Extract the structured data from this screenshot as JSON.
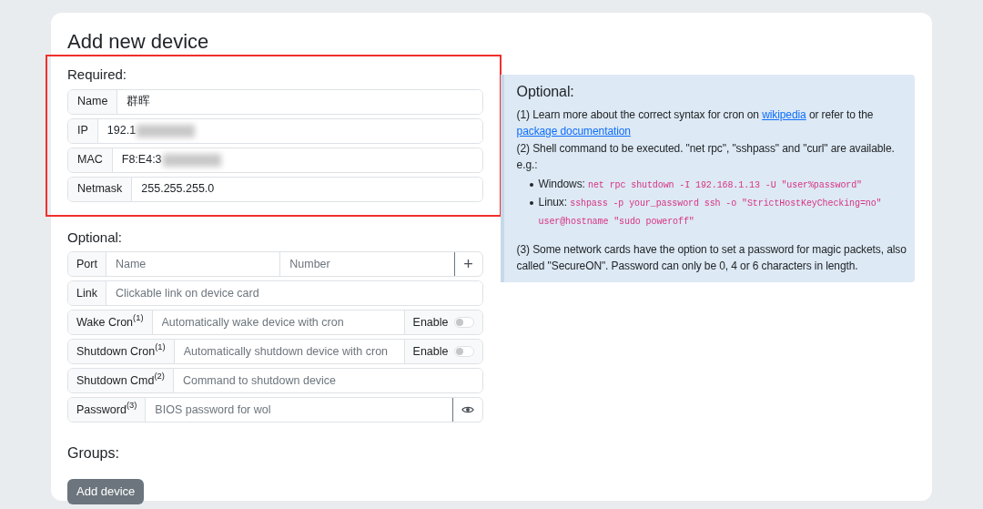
{
  "title": "Add new device",
  "required": {
    "label": "Required:",
    "highlighted": true,
    "fields": [
      {
        "label": "Name",
        "value": "群晖",
        "redacted": false
      },
      {
        "label": "IP",
        "value": "192.1",
        "redacted": true
      },
      {
        "label": "MAC",
        "value": "F8:E4:3",
        "redacted": true
      },
      {
        "label": "Netmask",
        "value": "255.255.255.0",
        "redacted": false
      }
    ]
  },
  "optional": {
    "label": "Optional:",
    "fields": [
      {
        "kind": "port",
        "label": "Port",
        "placeholders": [
          "Name",
          "Number"
        ],
        "button": "+"
      },
      {
        "kind": "text",
        "label": "Link",
        "placeholder": "Clickable link on device card"
      },
      {
        "kind": "toggle",
        "label": "Wake Cron$^{(1)}$",
        "placeholder": "Automatically wake device with cron",
        "toggle_label": "Enable",
        "on": false
      },
      {
        "kind": "toggle",
        "label": "Shutdown Cron$^{(1)}$",
        "placeholder": "Automatically shutdown device with cron",
        "toggle_label": "Enable",
        "on": false
      },
      {
        "kind": "text",
        "label": "Shutdown Cmd$^{(2)}$",
        "placeholder": "Command to shutdown device"
      },
      {
        "kind": "password",
        "label": "Password$^{(3)}$",
        "placeholder": "BIOS password for wol"
      }
    ]
  },
  "groups": {
    "label": "Groups:"
  },
  "submit": "Add device",
  "help": {
    "title": "Optional:",
    "blocks": [
      {
        "kind": "paragraph",
        "parts": [
          {
            "kind": "text",
            "text": "(1) Learn more about the correct syntax for cron on "
          },
          {
            "kind": "link",
            "text": "wikipedia"
          },
          {
            "kind": "text",
            "text": " or refer to the "
          },
          {
            "kind": "link",
            "text": "package documentation"
          }
        ]
      },
      {
        "kind": "paragraph",
        "parts": [
          {
            "kind": "text",
            "text": "(2) Shell command to be executed. \"net rpc\", \"sshpass\" and \"curl\" are available. e.g.:"
          }
        ]
      },
      {
        "kind": "list",
        "items": [
          {
            "label": "Windows:",
            "code": "net rpc shutdown -I 192.168.1.13 -U \"user%password\""
          },
          {
            "label": "Linux:",
            "code": "sshpass -p your_password ssh -o \"StrictHostKeyChecking=no\" user@hostname \"sudo poweroff\""
          }
        ]
      },
      {
        "kind": "paragraph",
        "parts": [
          {
            "kind": "text",
            "text": "(3) Some network cards have the option to set a password for magic packets, also called \"SecureON\". Password can only be 0, 4 or 6 characters in length."
          }
        ]
      }
    ]
  }
}
